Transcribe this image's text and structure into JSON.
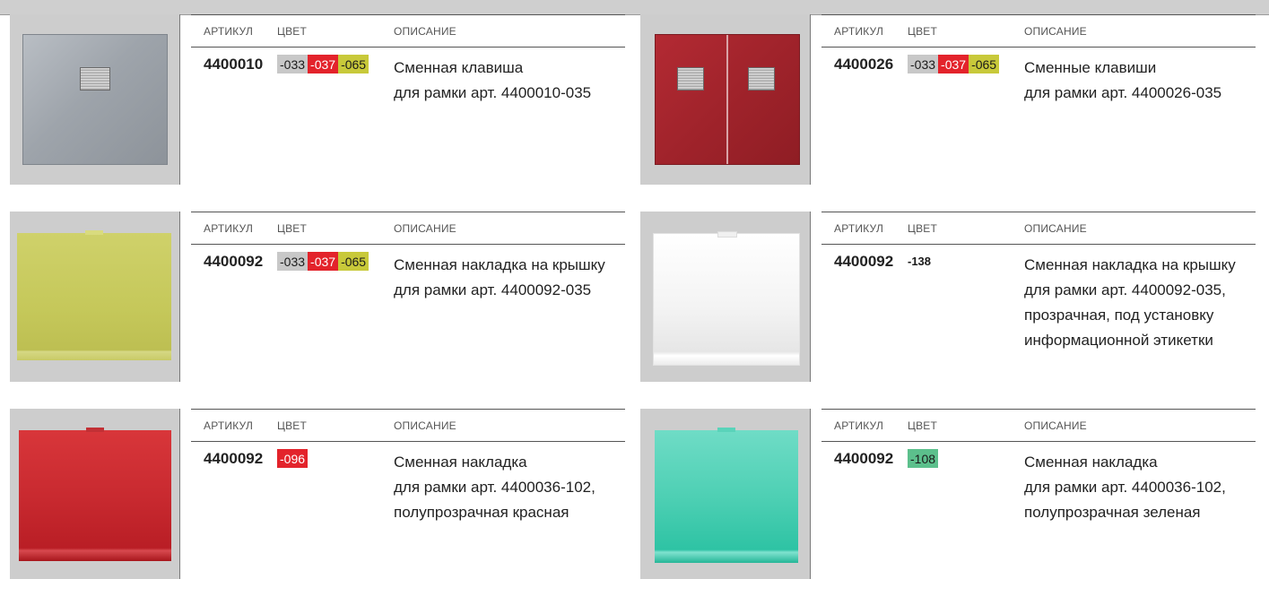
{
  "headers": {
    "article": "АРТИКУЛ",
    "color": "ЦВЕТ",
    "description": "ОПИСАНИЕ"
  },
  "colors": {
    "grey": "#c8c8c8",
    "red": "#e3232b",
    "lime": "#c8c93a",
    "green": "#5cc08c"
  },
  "products": [
    {
      "article": "4400010",
      "chips": [
        {
          "label": "-033",
          "tone": "grey"
        },
        {
          "label": "-037",
          "tone": "red"
        },
        {
          "label": "-065",
          "tone": "lime"
        }
      ],
      "description_lines": [
        "Сменная клавиша",
        "для рамки арт. 4400010-035"
      ],
      "image": "silver-single-rocker-switch"
    },
    {
      "article": "4400026",
      "chips": [
        {
          "label": "-033",
          "tone": "grey"
        },
        {
          "label": "-037",
          "tone": "red"
        },
        {
          "label": "-065",
          "tone": "lime"
        }
      ],
      "description_lines": [
        "Сменные клавиши",
        "для рамки арт. 4400026-035"
      ],
      "image": "red-double-rocker-switch"
    },
    {
      "article": "4400092",
      "chips": [
        {
          "label": "-033",
          "tone": "grey"
        },
        {
          "label": "-037",
          "tone": "red"
        },
        {
          "label": "-065",
          "tone": "lime"
        }
      ],
      "description_lines": [
        "Сменная накладка на крышку",
        "для рамки арт. 4400092-035"
      ],
      "image": "lime-cover-plate"
    },
    {
      "article": "4400092",
      "chips": [
        {
          "label": "-138",
          "tone": "plain"
        }
      ],
      "description_lines": [
        "Сменная накладка на крышку",
        "для рамки арт. 4400092-035,",
        "прозрачная, под установку",
        "информационной этикетки"
      ],
      "image": "transparent-cover-plate"
    },
    {
      "article": "4400092",
      "chips": [
        {
          "label": "-096",
          "tone": "red"
        }
      ],
      "description_lines": [
        "Сменная накладка",
        "для рамки арт. 4400036-102,",
        "полупрозрачная красная"
      ],
      "image": "red-translucent-cover-plate"
    },
    {
      "article": "4400092",
      "chips": [
        {
          "label": "-108",
          "tone": "green"
        }
      ],
      "description_lines": [
        "Сменная накладка",
        "для рамки арт. 4400036-102,",
        "полупрозрачная зеленая"
      ],
      "image": "green-translucent-cover-plate"
    }
  ]
}
